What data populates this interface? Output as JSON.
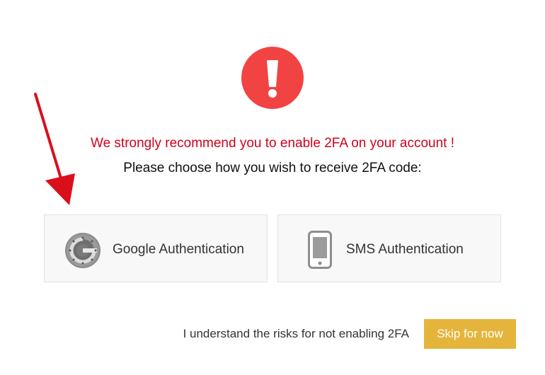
{
  "alert": {
    "icon": "exclamation-icon",
    "color": "#f24343"
  },
  "annotation": {
    "icon": "red-arrow-icon",
    "color": "#d9101b"
  },
  "headline": "We strongly recommend you to enable 2FA on your account !",
  "subline": "Please choose how you wish to receive 2FA code:",
  "options": [
    {
      "label": "Google Authentication",
      "icon": "google-authenticator-icon"
    },
    {
      "label": "SMS Authentication",
      "icon": "smartphone-icon"
    }
  ],
  "footer": {
    "risk_text": "I understand the risks for not enabling 2FA",
    "skip_label": "Skip for now",
    "skip_color": "#e5b53b"
  },
  "colors": {
    "headline": "#d0021b",
    "card_background": "#f8f8f8"
  }
}
